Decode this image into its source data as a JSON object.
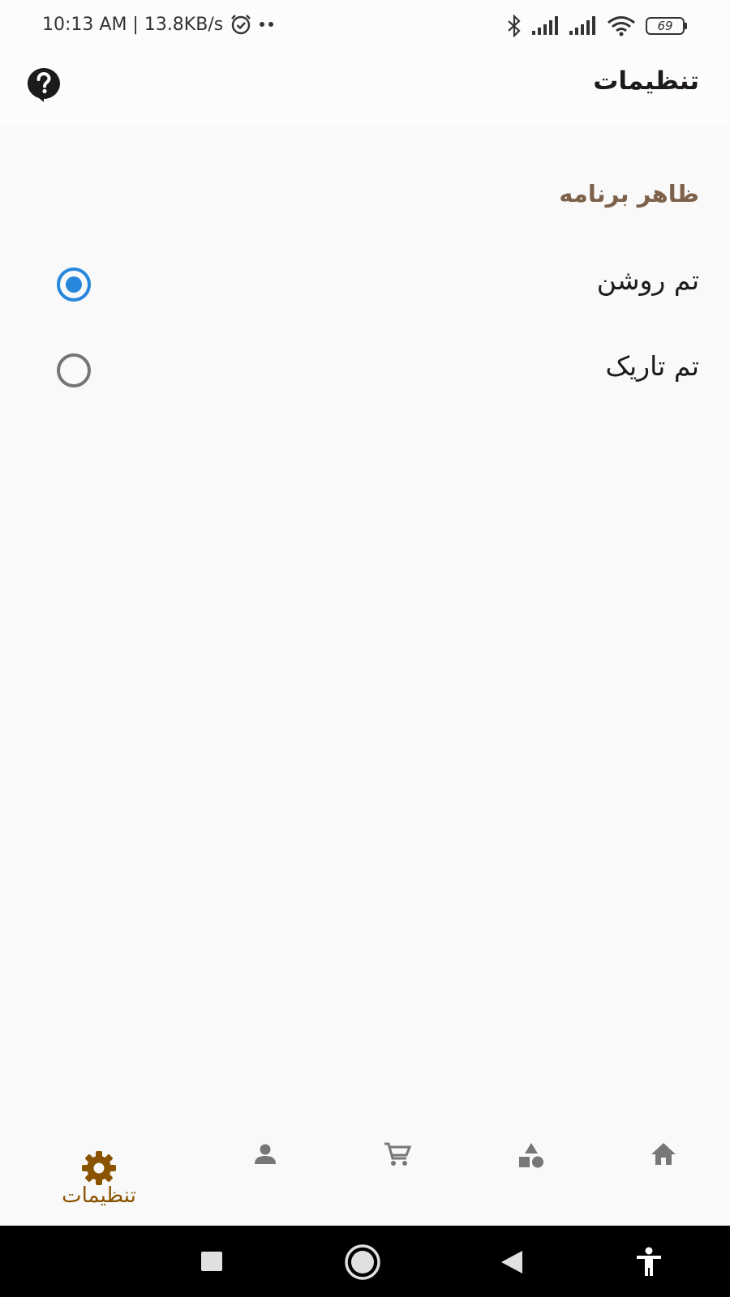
{
  "status_bar": {
    "time_speed": "10:13 AM | 13.8KB/s",
    "battery_level": "69",
    "icons": [
      "alarm-icon",
      "notification-dots-icon",
      "bluetooth-icon",
      "signal-icon",
      "wifi-icon",
      "battery-icon"
    ]
  },
  "app_bar": {
    "title": "تنظیمات",
    "help_icon": "help-icon"
  },
  "settings": {
    "section_title": "ظاهر برنامه",
    "options": [
      {
        "label": "تم روشن",
        "selected": true
      },
      {
        "label": "تم تاریک",
        "selected": false
      }
    ]
  },
  "bottom_nav": {
    "items": [
      {
        "icon": "gear-icon",
        "label": "تنظیمات",
        "active": true
      },
      {
        "icon": "person-icon",
        "label": "",
        "active": false
      },
      {
        "icon": "cart-icon",
        "label": "",
        "active": false
      },
      {
        "icon": "categories-icon",
        "label": "",
        "active": false
      },
      {
        "icon": "home-icon",
        "label": "",
        "active": false
      }
    ]
  },
  "system_nav": {
    "icons": [
      "recents-icon",
      "home-circle-icon",
      "back-icon",
      "accessibility-icon"
    ]
  },
  "colors": {
    "accent_brown": "#8a5300",
    "section_title": "#7d6148",
    "radio_selected": "#2687dc",
    "radio_unselected": "#757575",
    "nav_inactive": "#777777",
    "background": "#f8f9f8",
    "app_bar": "#fefbfd"
  }
}
